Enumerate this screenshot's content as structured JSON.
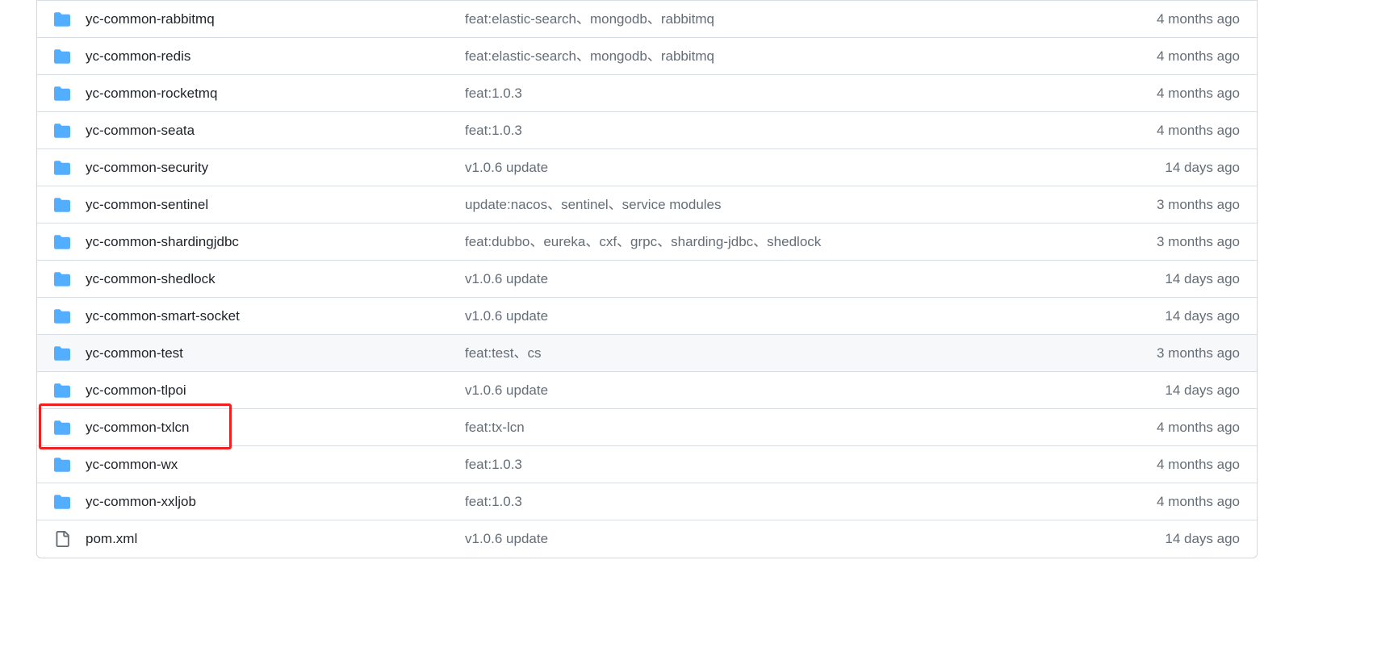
{
  "files": [
    {
      "name": "yc-common-rabbitmq",
      "type": "folder",
      "message": "feat:elastic-search、mongodb、rabbitmq",
      "age": "4 months ago"
    },
    {
      "name": "yc-common-redis",
      "type": "folder",
      "message": "feat:elastic-search、mongodb、rabbitmq",
      "age": "4 months ago"
    },
    {
      "name": "yc-common-rocketmq",
      "type": "folder",
      "message": "feat:1.0.3",
      "age": "4 months ago"
    },
    {
      "name": "yc-common-seata",
      "type": "folder",
      "message": "feat:1.0.3",
      "age": "4 months ago"
    },
    {
      "name": "yc-common-security",
      "type": "folder",
      "message": "v1.0.6 update",
      "age": "14 days ago"
    },
    {
      "name": "yc-common-sentinel",
      "type": "folder",
      "message": "update:nacos、sentinel、service modules",
      "age": "3 months ago"
    },
    {
      "name": "yc-common-shardingjdbc",
      "type": "folder",
      "message": "feat:dubbo、eureka、cxf、grpc、sharding-jdbc、shedlock",
      "age": "3 months ago"
    },
    {
      "name": "yc-common-shedlock",
      "type": "folder",
      "message": "v1.0.6 update",
      "age": "14 days ago"
    },
    {
      "name": "yc-common-smart-socket",
      "type": "folder",
      "message": "v1.0.6 update",
      "age": "14 days ago"
    },
    {
      "name": "yc-common-test",
      "type": "folder",
      "message": "feat:test、cs",
      "age": "3 months ago"
    },
    {
      "name": "yc-common-tlpoi",
      "type": "folder",
      "message": "v1.0.6 update",
      "age": "14 days ago"
    },
    {
      "name": "yc-common-txlcn",
      "type": "folder",
      "message": "feat:tx-lcn",
      "age": "4 months ago"
    },
    {
      "name": "yc-common-wx",
      "type": "folder",
      "message": "feat:1.0.3",
      "age": "4 months ago"
    },
    {
      "name": "yc-common-xxljob",
      "type": "folder",
      "message": "feat:1.0.3",
      "age": "4 months ago"
    },
    {
      "name": "pom.xml",
      "type": "file",
      "message": "v1.0.6 update",
      "age": "14 days ago"
    }
  ],
  "colors": {
    "folder_icon": "#54aeff",
    "file_icon": "#656d76",
    "highlight_box": "#ee2020",
    "hover_row": "#f6f8fa"
  }
}
